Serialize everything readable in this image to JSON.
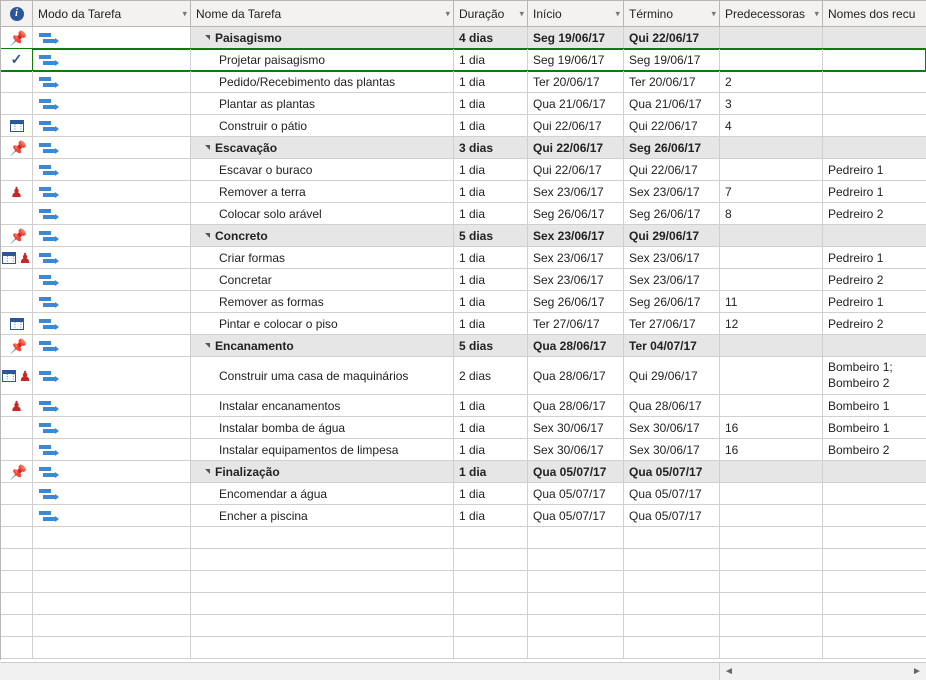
{
  "header": {
    "info_tooltip": "i",
    "col_mode": "Modo da Tarefa",
    "col_name": "Nome da Tarefa",
    "col_duration": "Duração",
    "col_start": "Início",
    "col_finish": "Término",
    "col_predecessors": "Predecessoras",
    "col_resources": "Nomes dos recu"
  },
  "rows": [
    {
      "type": "summary",
      "indicators": [
        "pin"
      ],
      "mode": "auto",
      "name": "Paisagismo",
      "indent": 1,
      "duration": "4 dias",
      "start": "Seg 19/06/17",
      "finish": "Qui 22/06/17",
      "pred": "",
      "res": ""
    },
    {
      "type": "task",
      "indicators": [
        "check"
      ],
      "mode": "auto",
      "name": "Projetar paisagismo",
      "indent": 2,
      "duration": "1 dia",
      "start": "Seg 19/06/17",
      "finish": "Seg 19/06/17",
      "pred": "",
      "res": "",
      "selected": true
    },
    {
      "type": "task",
      "indicators": [],
      "mode": "auto",
      "name": "Pedido/Recebimento das plantas",
      "indent": 2,
      "duration": "1 dia",
      "start": "Ter 20/06/17",
      "finish": "Ter 20/06/17",
      "pred": "2",
      "res": ""
    },
    {
      "type": "task",
      "indicators": [],
      "mode": "auto",
      "name": "Plantar as plantas",
      "indent": 2,
      "duration": "1 dia",
      "start": "Qua 21/06/17",
      "finish": "Qua 21/06/17",
      "pred": "3",
      "res": ""
    },
    {
      "type": "task",
      "indicators": [
        "cal"
      ],
      "mode": "auto",
      "name": "Construir o pátio",
      "indent": 2,
      "duration": "1 dia",
      "start": "Qui 22/06/17",
      "finish": "Qui 22/06/17",
      "pred": "4",
      "res": ""
    },
    {
      "type": "summary",
      "indicators": [
        "pin"
      ],
      "mode": "auto",
      "name": "Escavação",
      "indent": 1,
      "duration": "3 dias",
      "start": "Qui 22/06/17",
      "finish": "Seg 26/06/17",
      "pred": "",
      "res": ""
    },
    {
      "type": "task",
      "indicators": [],
      "mode": "auto",
      "name": "Escavar o buraco",
      "indent": 2,
      "duration": "1 dia",
      "start": "Qui 22/06/17",
      "finish": "Qui 22/06/17",
      "pred": "",
      "res": "Pedreiro 1"
    },
    {
      "type": "task",
      "indicators": [
        "person"
      ],
      "mode": "auto",
      "name": "Remover a terra",
      "indent": 2,
      "duration": "1 dia",
      "start": "Sex 23/06/17",
      "finish": "Sex 23/06/17",
      "pred": "7",
      "res": "Pedreiro 1"
    },
    {
      "type": "task",
      "indicators": [],
      "mode": "auto",
      "name": "Colocar solo arável",
      "indent": 2,
      "duration": "1 dia",
      "start": "Seg 26/06/17",
      "finish": "Seg 26/06/17",
      "pred": "8",
      "res": "Pedreiro 2"
    },
    {
      "type": "summary",
      "indicators": [
        "pin"
      ],
      "mode": "auto",
      "name": "Concreto",
      "indent": 1,
      "duration": "5 dias",
      "start": "Sex 23/06/17",
      "finish": "Qui 29/06/17",
      "pred": "",
      "res": ""
    },
    {
      "type": "task",
      "indicators": [
        "cal",
        "person"
      ],
      "mode": "auto",
      "name": "Criar formas",
      "indent": 2,
      "duration": "1 dia",
      "start": "Sex 23/06/17",
      "finish": "Sex 23/06/17",
      "pred": "",
      "res": "Pedreiro 1"
    },
    {
      "type": "task",
      "indicators": [],
      "mode": "auto",
      "name": "Concretar",
      "indent": 2,
      "duration": "1 dia",
      "start": "Sex 23/06/17",
      "finish": "Sex 23/06/17",
      "pred": "",
      "res": "Pedreiro 2"
    },
    {
      "type": "task",
      "indicators": [],
      "mode": "auto",
      "name": "Remover as formas",
      "indent": 2,
      "duration": "1 dia",
      "start": "Seg 26/06/17",
      "finish": "Seg 26/06/17",
      "pred": "11",
      "res": "Pedreiro 1"
    },
    {
      "type": "task",
      "indicators": [
        "cal"
      ],
      "mode": "auto",
      "name": "Pintar e colocar o piso",
      "indent": 2,
      "duration": "1 dia",
      "start": "Ter 27/06/17",
      "finish": "Ter 27/06/17",
      "pred": "12",
      "res": "Pedreiro 2"
    },
    {
      "type": "summary",
      "indicators": [
        "pin"
      ],
      "mode": "auto",
      "name": "Encanamento",
      "indent": 1,
      "duration": "5 dias",
      "start": "Qua 28/06/17",
      "finish": "Ter 04/07/17",
      "pred": "",
      "res": ""
    },
    {
      "type": "task",
      "indicators": [
        "cal",
        "person"
      ],
      "mode": "auto",
      "name": "Construir uma casa de maquinários",
      "indent": 2,
      "duration": "2 dias",
      "start": "Qua 28/06/17",
      "finish": "Qui 29/06/17",
      "pred": "",
      "res": "Bombeiro 1; Bombeiro 2",
      "tall": true
    },
    {
      "type": "task",
      "indicators": [
        "person"
      ],
      "mode": "auto",
      "name": "Instalar encanamentos",
      "indent": 2,
      "duration": "1 dia",
      "start": "Qua 28/06/17",
      "finish": "Qua 28/06/17",
      "pred": "",
      "res": "Bombeiro 1"
    },
    {
      "type": "task",
      "indicators": [],
      "mode": "auto",
      "name": "Instalar bomba de água",
      "indent": 2,
      "duration": "1 dia",
      "start": "Sex 30/06/17",
      "finish": "Sex 30/06/17",
      "pred": "16",
      "res": "Bombeiro 1"
    },
    {
      "type": "task",
      "indicators": [],
      "mode": "auto",
      "name": "Instalar equipamentos de limpesa",
      "indent": 2,
      "duration": "1 dia",
      "start": "Sex 30/06/17",
      "finish": "Sex 30/06/17",
      "pred": "16",
      "res": "Bombeiro 2"
    },
    {
      "type": "summary",
      "indicators": [
        "pin"
      ],
      "mode": "auto",
      "name": "Finalização",
      "indent": 1,
      "duration": "1 dia",
      "start": "Qua 05/07/17",
      "finish": "Qua 05/07/17",
      "pred": "",
      "res": ""
    },
    {
      "type": "task",
      "indicators": [],
      "mode": "auto",
      "name": "Encomendar a água",
      "indent": 2,
      "duration": "1 dia",
      "start": "Qua 05/07/17",
      "finish": "Qua 05/07/17",
      "pred": "",
      "res": ""
    },
    {
      "type": "task",
      "indicators": [],
      "mode": "auto",
      "name": "Encher a piscina",
      "indent": 2,
      "duration": "1 dia",
      "start": "Qua 05/07/17",
      "finish": "Qua 05/07/17",
      "pred": "",
      "res": ""
    },
    {
      "type": "empty"
    },
    {
      "type": "empty"
    },
    {
      "type": "empty"
    },
    {
      "type": "empty"
    },
    {
      "type": "empty"
    },
    {
      "type": "empty"
    }
  ]
}
